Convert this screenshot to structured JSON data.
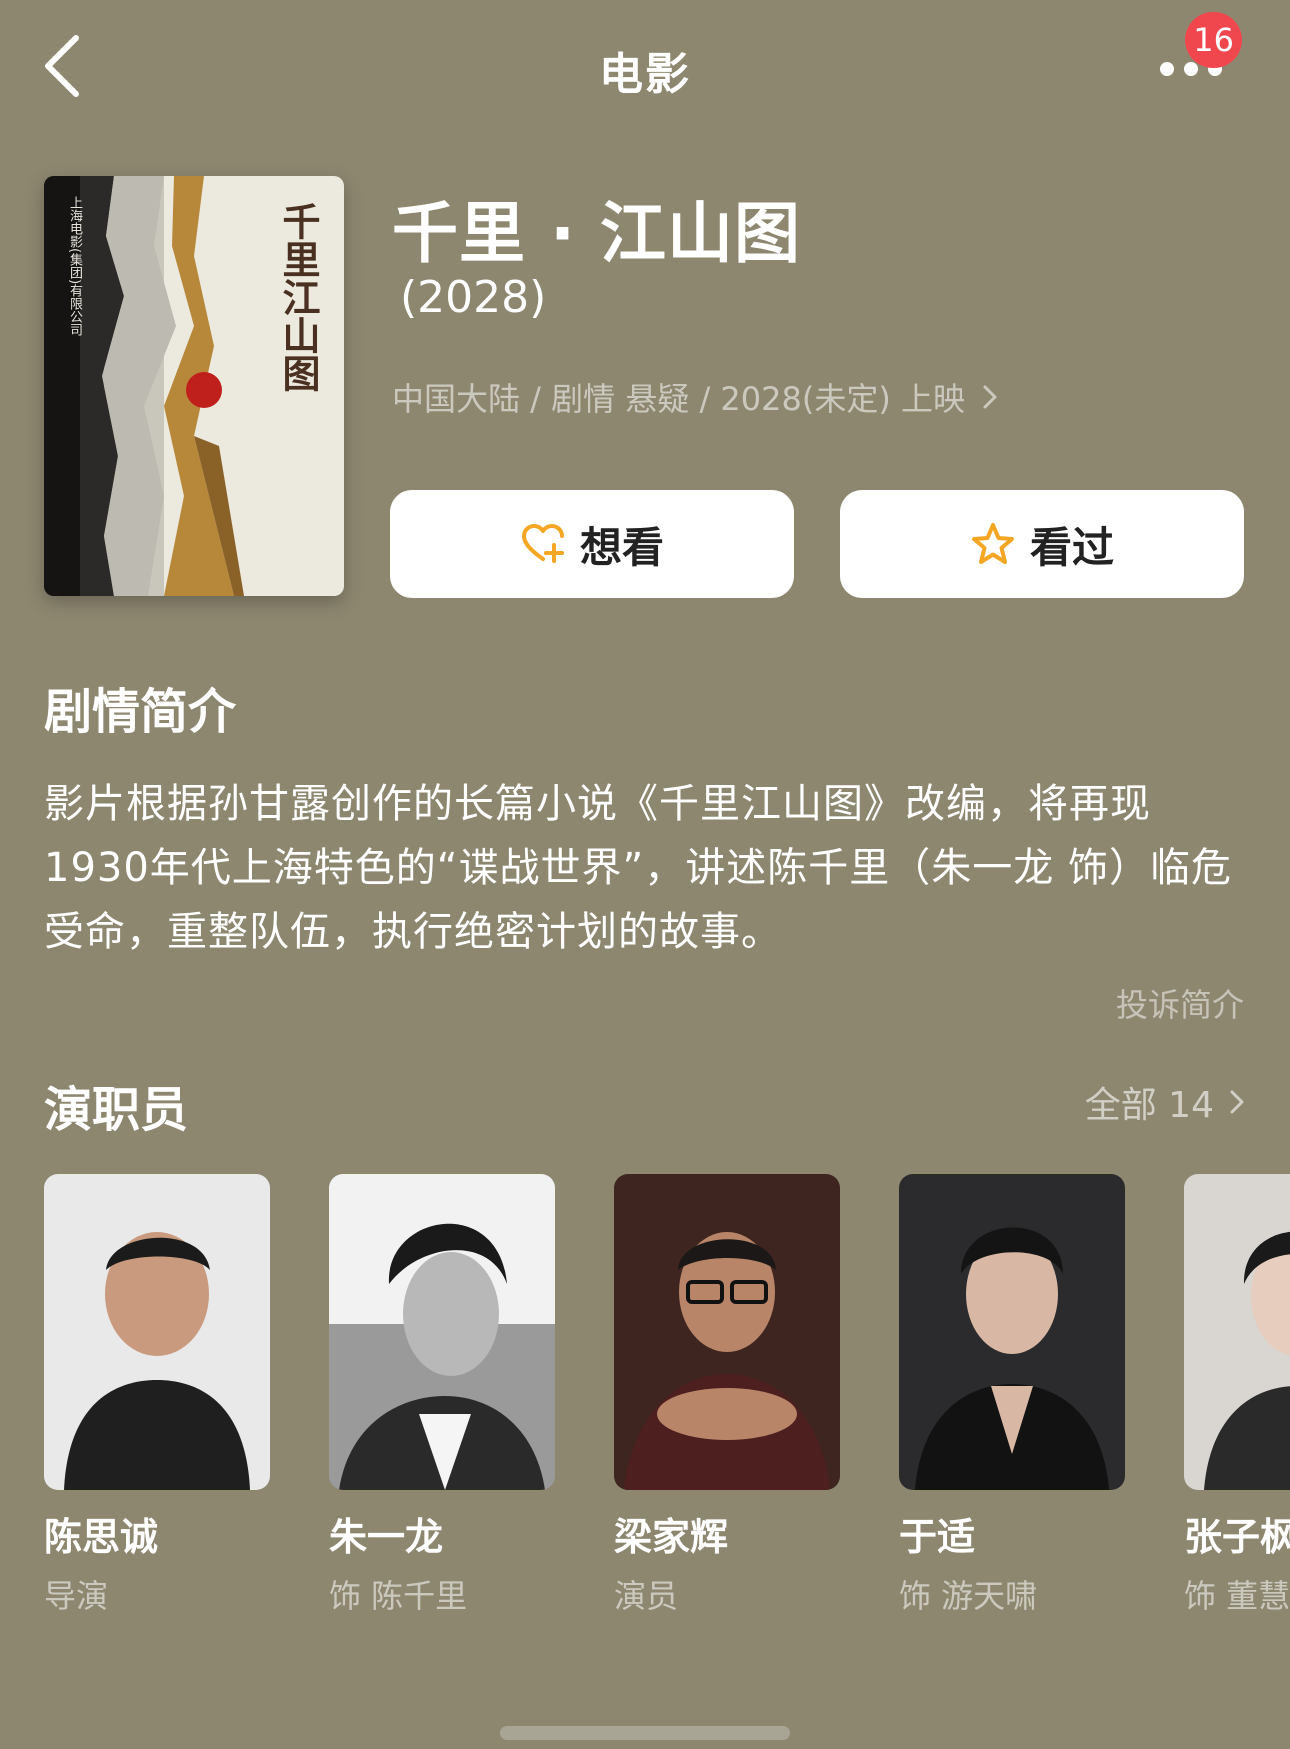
{
  "nav": {
    "title": "电影",
    "badge_count": "16"
  },
  "movie": {
    "title": "千里 · 江山图",
    "year": "(2028)",
    "meta": "中国大陆 / 剧情 悬疑 / 2028(未定) 上映",
    "poster": {
      "title": "千里江山图",
      "side_text": "上海电影(集团)有限公司"
    }
  },
  "actions": {
    "want_label": "想看",
    "seen_label": "看过"
  },
  "synopsis": {
    "title": "剧情简介",
    "text": "影片根据孙甘露创作的长篇小说《千里江山图》改编，将再现1930年代上海特色的“谍战世界”，讲述陈千里（朱一龙 饰）临危受命，重整队伍，执行绝密计划的故事。",
    "report_label": "投诉简介"
  },
  "cast": {
    "title": "演职员",
    "all_label": "全部 14",
    "members": [
      {
        "name": "陈思诚",
        "role": "导演",
        "photo_bg": "#e9e9e9"
      },
      {
        "name": "朱一龙",
        "role": "饰 陈千里",
        "photo_bg": "#8a8a8a"
      },
      {
        "name": "梁家辉",
        "role": "演员",
        "photo_bg": "#4a2b24"
      },
      {
        "name": "于适",
        "role": "饰 游天啸",
        "photo_bg": "#2a2a2c"
      },
      {
        "name": "张子枫",
        "role": "饰 董慧",
        "photo_bg": "#d9d6d2"
      }
    ]
  },
  "colors": {
    "background": "#8d8770",
    "accent": "#f5a623",
    "badge": "#f0474f"
  }
}
